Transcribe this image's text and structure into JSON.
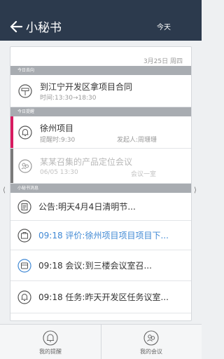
{
  "header": {
    "title": "小秘书",
    "today_label": "今天"
  },
  "date_line": "3月25日 周四",
  "sections": {
    "trip": "今日去向",
    "reminder": "今日提醒",
    "messages": "小秘书消息"
  },
  "trip": {
    "title": "到江宁开发区拿项目合同",
    "time": "时间:13:30→18:30",
    "icon": "signpost-icon"
  },
  "reminders": [
    {
      "title": "徐州项目",
      "sub": "提醒时:9:30",
      "sub2": "发起人:周珊珊",
      "accent": "#d81b60",
      "icon": "bell-icon"
    },
    {
      "title": "某某召集的产品定位会议",
      "sub": "06/05 13:30",
      "sub2": "会议一室",
      "accent": "#7a7a7a",
      "icon": "meeting-icon"
    }
  ],
  "messages": [
    {
      "text": "公告:明天4月4日清明节...",
      "icon": "notice-icon"
    },
    {
      "text": "09:18  评价:徐州项目项目项目下...",
      "icon": "review-icon",
      "highlight": true
    },
    {
      "text": "09:18  会议:到三楼会议室召...",
      "icon": "meeting-message-icon"
    },
    {
      "text": "09:18  任务:昨天开发区任务议室...",
      "icon": "task-bell-icon"
    }
  ],
  "nav_arrows": {
    "left": "⟨",
    "right": "⟩"
  },
  "footer": {
    "tab1": "我的提醒",
    "tab2": "我的会议"
  },
  "colors": {
    "header_bg": "#2c3a4d",
    "highlight_text": "#3f88d4",
    "reminder_accent": "#d81b60"
  }
}
